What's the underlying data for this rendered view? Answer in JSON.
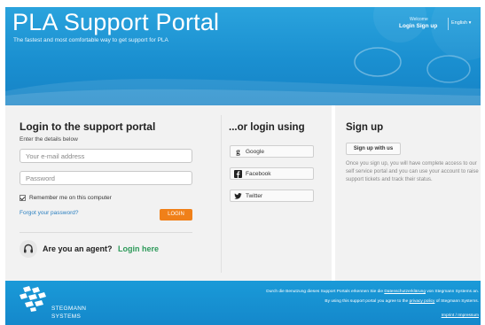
{
  "header": {
    "title": "PLA Support Portal",
    "tagline": "The fastest and most comfortable way to get support for PLA",
    "welcome": "Welcome",
    "login_link": "Login",
    "signup_link": "Sign up",
    "language": "English"
  },
  "login": {
    "title": "Login to the support portal",
    "subtitle": "Enter the details below",
    "email_placeholder": "Your e-mail address",
    "password_placeholder": "Password",
    "remember_label": "Remember me on this computer",
    "remember_checked": true,
    "forgot_link": "Forgot your password?",
    "login_button": "LOGIN",
    "agent_question": "Are you an agent?",
    "agent_link": "Login here"
  },
  "social": {
    "title": "...or login using",
    "google": "Google",
    "facebook": "Facebook",
    "twitter": "Twitter"
  },
  "signup": {
    "title": "Sign up",
    "button": "Sign up with us",
    "description": "Once you sign up, you will have complete access to our self service portal and you can use your account to raise support tickets and track their status."
  },
  "footer": {
    "logo_line1": "STEGMANN",
    "logo_line2": "SYSTEMS",
    "de_text_before": "Durch die Benutzung dieses Support Portals erkennen Sie die ",
    "de_link": "Datenschutzerklärung",
    "de_text_after": " von Stegmann Systems an.",
    "en_text_before": "By using this support portal you agree to the ",
    "en_link": "privacy policy",
    "en_text_after": " of Stegmann Systems.",
    "imprint": "Imprint / Impressum"
  },
  "colors": {
    "header_blue": "#1a8fd0",
    "login_orange": "#f08019",
    "agent_green": "#2e9a5a",
    "link_blue": "#2a7fc0"
  }
}
